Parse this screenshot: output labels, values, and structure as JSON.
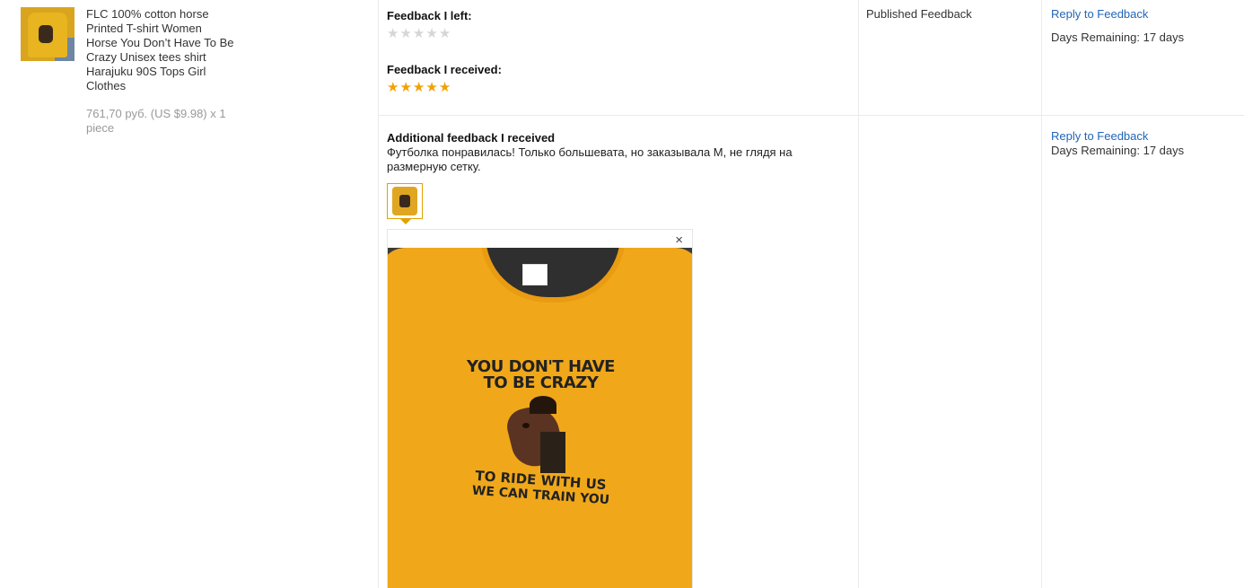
{
  "product": {
    "title": "FLC 100% cotton horse Printed T-shirt Women Horse You Don’t Have To Be Crazy Unisex tees shirt Harajuku 90S Tops Girl Clothes",
    "price": "761,70 руб. (US $9.98) x 1 piece"
  },
  "feedback": {
    "left_label": "Feedback I left:",
    "left_stars": 0,
    "received_label": "Feedback I received:",
    "received_stars": 5,
    "additional_label": "Additional feedback I received",
    "additional_text": "Футболка понравилась! Только большевата, но заказывала М, не глядя на размерную сетку."
  },
  "preview": {
    "close_glyph": "×",
    "shirt_text_line1": "YOU DON'T HAVE",
    "shirt_text_line2": "TO BE CRAZY",
    "shirt_text_line3": "TO RIDE WITH US",
    "shirt_text_line4": "WE CAN TRAIN YOU"
  },
  "status": {
    "label": "Published Feedback"
  },
  "actions": {
    "row1_reply": "Reply to Feedback",
    "row1_days": "Days Remaining: 17 days",
    "row2_reply": "Reply to Feedback",
    "row2_days": "Days Remaining: 17 days"
  },
  "colors": {
    "link": "#2166b7",
    "star_full": "#f2a100",
    "star_empty": "#d6d6d6"
  }
}
